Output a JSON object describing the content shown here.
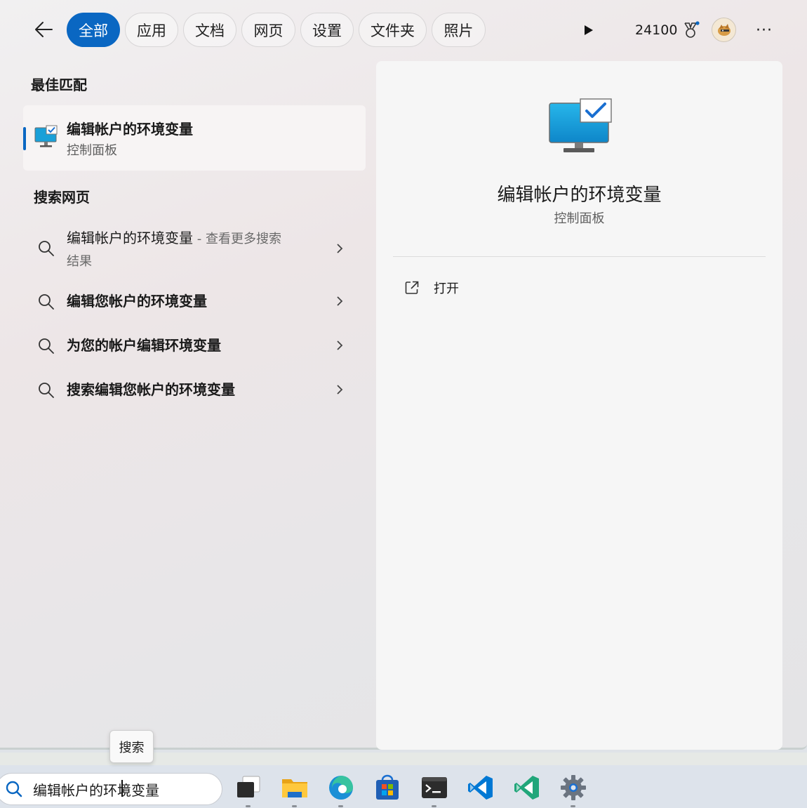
{
  "filters": {
    "back_icon": "arrow-left-icon",
    "tabs": [
      {
        "label": "全部",
        "active": true
      },
      {
        "label": "应用",
        "active": false
      },
      {
        "label": "文档",
        "active": false
      },
      {
        "label": "网页",
        "active": false
      },
      {
        "label": "设置",
        "active": false
      },
      {
        "label": "文件夹",
        "active": false
      },
      {
        "label": "照片",
        "active": false
      }
    ],
    "rewards_points": "24100",
    "more_label": "···"
  },
  "best_match": {
    "section_title": "最佳匹配",
    "title": "编辑帐户的环境变量",
    "subtitle": "控制面板",
    "icon": "monitor-check-icon"
  },
  "web_search": {
    "section_title": "搜索网页",
    "items": [
      {
        "query": "编辑帐户的环境变量",
        "suffix": " - 查看更多搜索",
        "suffix2": "结果"
      },
      {
        "query": "编辑您帐户的环境变量"
      },
      {
        "query": "为您的帐户编辑环境变量"
      },
      {
        "query": "搜索编辑您帐户的环境变量"
      }
    ]
  },
  "preview": {
    "title": "编辑帐户的环境变量",
    "subtitle": "控制面板",
    "open_label": "打开",
    "open_icon": "open-external-icon"
  },
  "tooltip": {
    "label": "搜索"
  },
  "taskbar": {
    "search_value": "编辑帐户的环境变量",
    "apps": [
      "task-view-icon",
      "file-explorer-icon",
      "edge-icon",
      "store-icon",
      "terminal-icon",
      "vscode-icon",
      "vscode-insiders-icon",
      "settings-icon"
    ]
  },
  "colors": {
    "accent": "#0a67c2"
  }
}
